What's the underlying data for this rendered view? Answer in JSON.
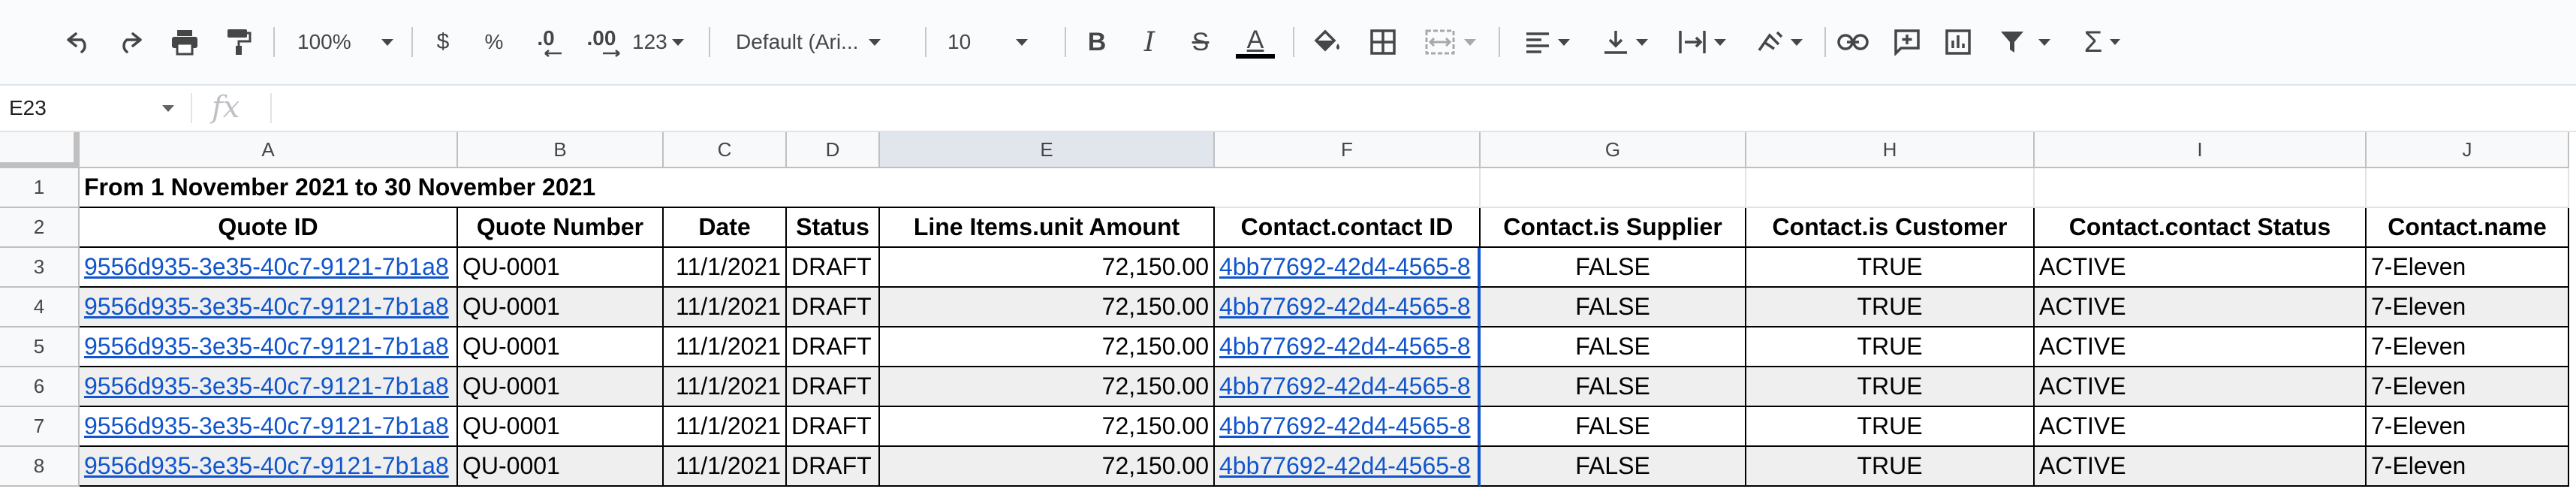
{
  "toolbar": {
    "zoom": "100%",
    "currency": "$",
    "percent": "%",
    "decrease_decimal": ".0",
    "increase_decimal": ".00",
    "more_formats": "123",
    "font": "Default (Ari...",
    "font_size": "10"
  },
  "formula_bar": {
    "cell_ref": "E23",
    "fx": "fx",
    "value": ""
  },
  "columns": [
    "A",
    "B",
    "C",
    "D",
    "E",
    "F",
    "G",
    "H",
    "I",
    "J"
  ],
  "selected_column": "E",
  "row_numbers": [
    "1",
    "2",
    "3",
    "4",
    "5",
    "6",
    "7",
    "8"
  ],
  "title": "From 1 November 2021 to 30 November 2021",
  "headers": [
    "Quote ID",
    "Quote Number",
    "Date",
    "Status",
    "Line Items.unit Amount",
    "Contact.contact ID",
    "Contact.is Supplier",
    "Contact.is Customer",
    "Contact.contact Status",
    "Contact.name"
  ],
  "rows": [
    [
      "9556d935-3e35-40c7-9121-7b1a8",
      "QU-0001",
      "11/1/2021",
      "DRAFT",
      "72,150.00",
      "4bb77692-42d4-4565-8",
      "FALSE",
      "TRUE",
      "ACTIVE",
      "7-Eleven"
    ],
    [
      "9556d935-3e35-40c7-9121-7b1a8",
      "QU-0001",
      "11/1/2021",
      "DRAFT",
      "72,150.00",
      "4bb77692-42d4-4565-8",
      "FALSE",
      "TRUE",
      "ACTIVE",
      "7-Eleven"
    ],
    [
      "9556d935-3e35-40c7-9121-7b1a8",
      "QU-0001",
      "11/1/2021",
      "DRAFT",
      "72,150.00",
      "4bb77692-42d4-4565-8",
      "FALSE",
      "TRUE",
      "ACTIVE",
      "7-Eleven"
    ],
    [
      "9556d935-3e35-40c7-9121-7b1a8",
      "QU-0001",
      "11/1/2021",
      "DRAFT",
      "72,150.00",
      "4bb77692-42d4-4565-8",
      "FALSE",
      "TRUE",
      "ACTIVE",
      "7-Eleven"
    ],
    [
      "9556d935-3e35-40c7-9121-7b1a8",
      "QU-0001",
      "11/1/2021",
      "DRAFT",
      "72,150.00",
      "4bb77692-42d4-4565-8",
      "FALSE",
      "TRUE",
      "ACTIVE",
      "7-Eleven"
    ],
    [
      "9556d935-3e35-40c7-9121-7b1a8",
      "QU-0001",
      "11/1/2021",
      "DRAFT",
      "72,150.00",
      "4bb77692-42d4-4565-8",
      "FALSE",
      "TRUE",
      "ACTIVE",
      "7-Eleven"
    ]
  ],
  "colors": {
    "link": "#1155cc",
    "banded_row": "#efefef",
    "header_bg": "#f8f9fa",
    "selected_header_bg": "#e1e5ec",
    "text_color_bar": "#000000"
  }
}
